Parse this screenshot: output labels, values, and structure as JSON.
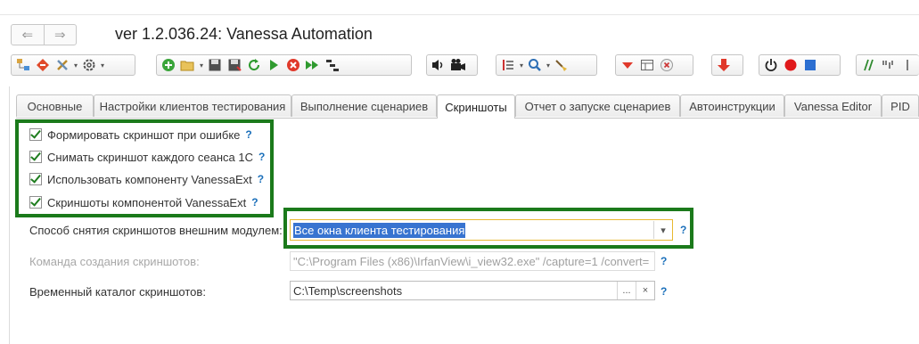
{
  "window": {
    "title": "ver 1.2.036.24: Vanessa Automation"
  },
  "nav": {
    "back_glyph": "⇐",
    "forward_glyph": "⇒"
  },
  "tabs": [
    {
      "label": "Основные"
    },
    {
      "label": "Настройки клиентов тестирования"
    },
    {
      "label": "Выполнение сценариев"
    },
    {
      "label": "Скриншоты"
    },
    {
      "label": "Отчет о запуске сценариев"
    },
    {
      "label": "Автоинструкции"
    },
    {
      "label": "Vanessa Editor"
    },
    {
      "label": "PID"
    }
  ],
  "active_tab": "Скриншоты",
  "checkboxes": [
    {
      "label": "Формировать скриншот при ошибке",
      "checked": true,
      "help": "?"
    },
    {
      "label": "Снимать скриншот каждого сеанса 1С",
      "checked": true,
      "help": "?"
    },
    {
      "label": "Использовать компоненту VanessaExt",
      "checked": true,
      "help": "?"
    },
    {
      "label": "Скриншоты компонентой VanessaExt",
      "checked": true,
      "help": "?"
    }
  ],
  "fields": {
    "method": {
      "label": "Способ снятия скриншотов внешним модулем:",
      "value": "Все окна клиента тестирования",
      "help": "?"
    },
    "command": {
      "label": "Команда создания скриншотов:",
      "value": "\"C:\\Program Files (x86)\\IrfanView\\i_view32.exe\" /capture=1 /convert=",
      "help": "?"
    },
    "temp_dir": {
      "label": "Временный каталог скриншотов:",
      "value": "C:\\Temp\\screenshots",
      "help": "?",
      "browse": "...",
      "clear": "×"
    }
  },
  "toolbar": {
    "icons": [
      "tree-structure-icon",
      "flow-icon",
      "tools-icon",
      "gear-icon",
      "add-icon",
      "open-file-icon",
      "save-icon",
      "save-as-icon",
      "refresh-icon",
      "run-icon",
      "stop-icon",
      "run-fast-icon",
      "steps-icon",
      "sound-icon",
      "video-camera-icon",
      "list-icon",
      "search-icon",
      "brush-icon",
      "collapse-icon",
      "table-icon",
      "clear-icon",
      "down-arrow-icon",
      "power-icon",
      "record-icon",
      "stop-record-icon",
      "comment-icon",
      "quotes-icon",
      "separator-icon"
    ],
    "dropdown_glyph": "▾"
  },
  "colors": {
    "highlight": "#1b7a1b",
    "accent": "#1a6fba",
    "selection": "#3874d0"
  }
}
